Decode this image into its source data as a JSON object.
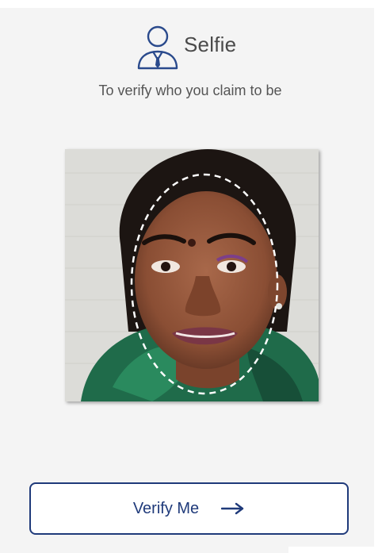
{
  "header": {
    "title": "Selfie",
    "icon": "user-icon"
  },
  "subtitle": "To verify who you claim to be",
  "photo": {
    "guide": "dashed-oval-face-guide"
  },
  "verify_button": {
    "label": "Verify Me",
    "icon": "arrow-right-icon"
  },
  "colors": {
    "accent": "#1f3a7a",
    "background": "#f4f4f4",
    "text": "#4a4a4a"
  }
}
